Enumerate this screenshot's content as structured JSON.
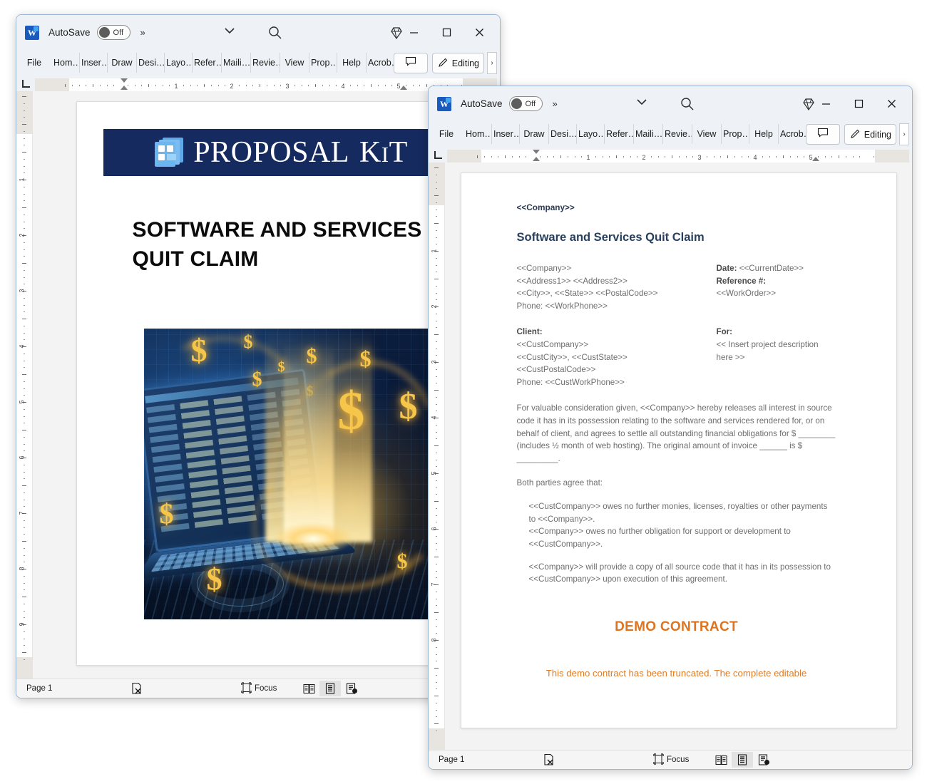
{
  "app": {
    "name": "Microsoft Word",
    "logo_letter": "W",
    "autosave_label": "AutoSave",
    "autosave_state": "Off",
    "quick_access_more": "»",
    "customize_icon": "chevron-down-icon",
    "search_icon": "search-icon",
    "diamond_icon": "diamond-icon",
    "minimize_label": "─",
    "maximize_label": "□",
    "close_label": "✕"
  },
  "ribbon": {
    "tabs": [
      "File",
      "Hom…",
      "Inser…",
      "Draw",
      "Desi…",
      "Layo…",
      "Refer…",
      "Maili…",
      "Revie…",
      "View",
      "Prop…",
      "Help",
      "Acrob…"
    ],
    "comment_icon": "comment-icon",
    "editing_label": "Editing",
    "editing_icon": "pencil-icon",
    "expand_label": "›"
  },
  "ruler": {
    "horizontal_numbers": [
      "1",
      "2",
      "3",
      "4",
      "5"
    ],
    "vertical_numbers_back": [
      "1",
      "2",
      "3",
      "4",
      "5",
      "6",
      "7",
      "8",
      "9"
    ],
    "vertical_numbers_front": [
      "1",
      "2",
      "3",
      "4",
      "5",
      "6",
      "7",
      "8"
    ],
    "tabstop_icon": "tab-stop-left-icon"
  },
  "statusbar": {
    "page_label": "Page 1",
    "proofing_icon": "proofing-errors-icon",
    "focus_label": "Focus",
    "focus_icon": "focus-icon",
    "views": [
      {
        "name": "read-mode-view",
        "icon": "book-icon",
        "active": false
      },
      {
        "name": "print-layout-view",
        "icon": "page-icon",
        "active": true
      },
      {
        "name": "web-layout-view",
        "icon": "web-page-icon",
        "active": false
      }
    ]
  },
  "document_back": {
    "banner": {
      "brand_primary": "PROPOSAL",
      "brand_k": "K",
      "brand_i": "I",
      "brand_t": "T",
      "background_color": "#152a5e",
      "logo_icon": "stacked-pages-icon"
    },
    "title_line1": "SOFTWARE AND SERVICES",
    "title_line2": "QUIT CLAIM",
    "cover_image_alt": "Blue laptop displaying a financial spreadsheet with golden dollar signs and light streams"
  },
  "document_front": {
    "company_tag": "<<Company>>",
    "title": "Software and Services Quit Claim",
    "sender": [
      "<<Company>>",
      "<<Address1>> <<Address2>>",
      "<<City>>, <<State>> <<PostalCode>>",
      "Phone: <<WorkPhone>>"
    ],
    "meta_date_label": "Date:",
    "meta_date_value": "<<CurrentDate>>",
    "meta_ref_label": "Reference #:",
    "meta_ref_value": "<<WorkOrder>>",
    "client_label": "Client:",
    "client_lines": [
      "<<CustCompany>>",
      "<<CustCity>>, <<CustState>>",
      "<<CustPostalCode>>",
      "Phone: <<CustWorkPhone>>"
    ],
    "for_label": "For:",
    "for_value": "<< Insert project description here >>",
    "body_paragraph": "For valuable consideration given, <<Company>> hereby releases all interest in source code it has in its possession relating to the software and services rendered for, or on behalf of client, and agrees to settle all outstanding financial obligations for $ ________ (includes ½ month of web hosting). The original amount of invoice ______ is $ _________.",
    "agree_intro": "Both parties agree that:",
    "agree_item_1": "<<CustCompany>> owes no further monies, licenses, royalties or other payments to <<Company>>.",
    "agree_item_2": "<<Company>> owes no further obligation for support or development to",
    "agree_item_3": "<<CustCompany>>.",
    "agree_item_4": "<<Company>> will provide a copy of all source code that it has in its possession to <<CustCompany>> upon execution of this agreement.",
    "demo_heading": "DEMO CONTRACT",
    "demo_notice": "This demo contract has been truncated. The complete editable",
    "demo_color": "#de7320"
  }
}
